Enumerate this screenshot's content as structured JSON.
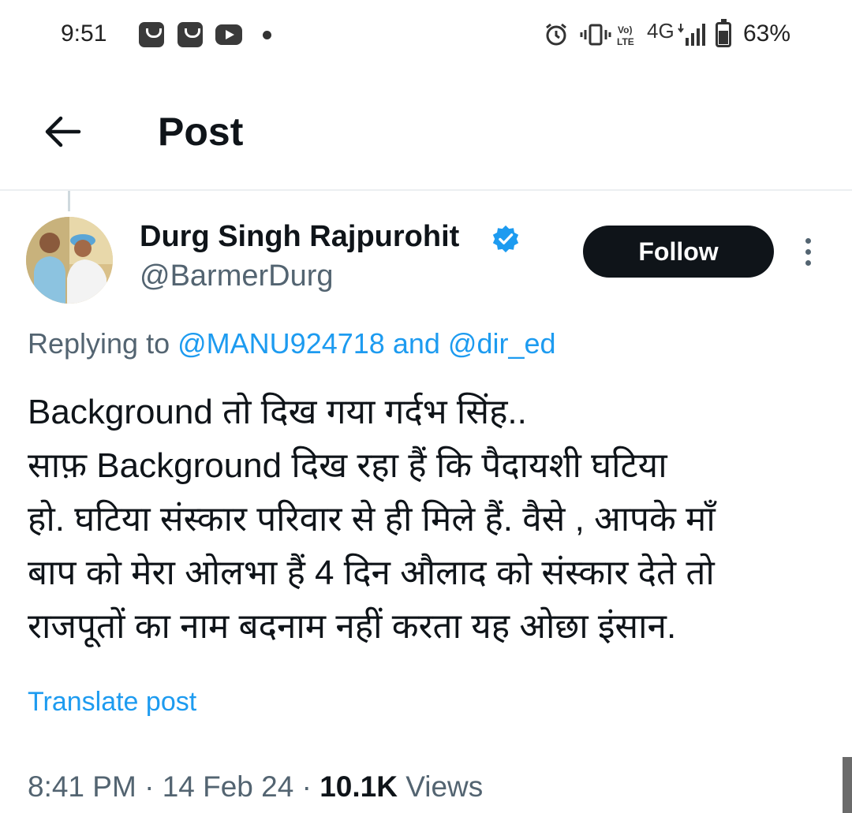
{
  "status_bar": {
    "time": "9:51",
    "network": "4G",
    "battery": "63%"
  },
  "header": {
    "title": "Post"
  },
  "author": {
    "display_name": "Durg Singh Rajpurohit",
    "handle": "@BarmerDurg",
    "verified": true
  },
  "follow_button": {
    "label": "Follow"
  },
  "reply_context": {
    "prefix": "Replying to",
    "mention_1": "@MANU924718",
    "conjunction": "and",
    "mention_2": "@dir_ed"
  },
  "tweet": {
    "lines": [
      "Background तो दिख गया गर्दभ सिंह..",
      "साफ़ Background दिख रहा हैं कि पैदायशी घटिया",
      "हो. घटिया संस्कार परिवार से ही मिले हैं. वैसे , आपके माँ",
      "बाप को मेरा ओलभा हैं 4 दिन औलाद को संस्कार देते तो",
      "राजपूतों का नाम बदनाम नहीं करता यह ओछा इंसान."
    ]
  },
  "translate_link": "Translate post",
  "meta": {
    "time": "8:41 PM",
    "separator": "·",
    "date": "14 Feb 24",
    "views_count": "10.1K",
    "views_label": "Views"
  },
  "colors": {
    "accent": "#1d9bf0",
    "text_primary": "#0f1419",
    "text_secondary": "#536471",
    "button_dark": "#0f1419"
  },
  "icons": {
    "back": "arrow-left-icon",
    "verified": "verified-badge-icon",
    "more": "more-vertical-icon"
  }
}
